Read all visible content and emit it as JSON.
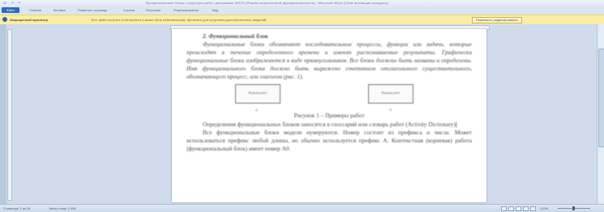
{
  "titlebar": {
    "quick_access": [
      "W",
      "↶",
      "↷"
    ],
    "title": "Функциональные блоки, структура работ, диаграммы IDEF0 [Режим ограниченной функциональности] - Microsoft Word (Сбой активации продукта)"
  },
  "ribbon": {
    "tabs": [
      "Файл",
      "Главная",
      "Вставка",
      "Разметка страницы",
      "Ссылки",
      "Рассылки",
      "Рецензирование",
      "Вид"
    ]
  },
  "message_bar": {
    "label": "Защищенный просмотр",
    "text": "Этот файл получен из Интернета и может быть небезопасным. Щелкните для получения дополнительных сведений.",
    "button": "Разрешить редактирование"
  },
  "document": {
    "heading": "2. Функциональный блок",
    "para1": "Функциональные блоки обозначают последовательные процессы, функции или задачи, которые происходят в течение определенного времени и имеют распознаваемые результаты. Графически функциональные блоки изображаются в виде прямоугольников. Все блоки должны быть названы и определены. Имя функционального блока должно быть выражено сочетанием отглагольного существительного, обозначающего процесс, или глаголом (рис. 1).",
    "figure": {
      "box_left": "Функция работ",
      "box_right": "Функция работ",
      "label_left": "а)",
      "label_right": "б)"
    },
    "caption": "Рисунок 1 – Примеры работ",
    "para2": "Определения функциональных блоков заносятся в глоссарий или словарь работ (Activity Dictionary)[",
    "para3": "Все функциональные блоки модели нумеруются. Номер состоит из префикса и числа. Может использоваться префикс любой длины, но обычно используется префикс A. Контекстная (корневая) работа (функциональный блок) имеет номер A0."
  },
  "statusbar": {
    "page": "Страница: 2 из 10",
    "words": "Число слов: 2 456",
    "zoom": "120%"
  }
}
